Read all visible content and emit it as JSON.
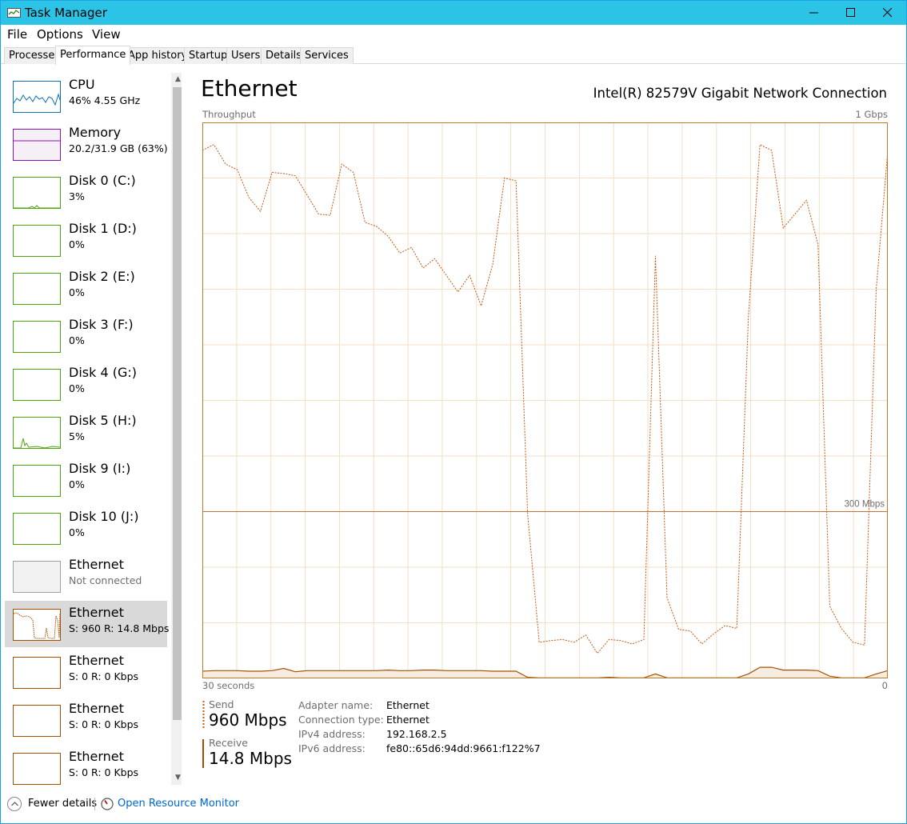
{
  "window": {
    "title": "Task Manager"
  },
  "menu": [
    "File",
    "Options",
    "View"
  ],
  "tabs": [
    "Processes",
    "Performance",
    "App history",
    "Startup",
    "Users",
    "Details",
    "Services"
  ],
  "active_tab": "Performance",
  "sidebar": {
    "items": [
      {
        "name": "CPU",
        "sub": "46%  4.55 GHz",
        "color": "#1171ae"
      },
      {
        "name": "Memory",
        "sub": "20.2/31.9 GB (63%)",
        "color": "#8b12ae"
      },
      {
        "name": "Disk 0 (C:)",
        "sub": "3%",
        "color": "#4da60c"
      },
      {
        "name": "Disk 1 (D:)",
        "sub": "0%",
        "color": "#4da60c"
      },
      {
        "name": "Disk 2 (E:)",
        "sub": "0%",
        "color": "#4da60c"
      },
      {
        "name": "Disk 3 (F:)",
        "sub": "0%",
        "color": "#4da60c"
      },
      {
        "name": "Disk 4 (G:)",
        "sub": "0%",
        "color": "#4da60c"
      },
      {
        "name": "Disk 5 (H:)",
        "sub": "5%",
        "color": "#4da60c"
      },
      {
        "name": "Disk 9 (I:)",
        "sub": "0%",
        "color": "#4da60c"
      },
      {
        "name": "Disk 10 (J:)",
        "sub": "0%",
        "color": "#4da60c"
      },
      {
        "name": "Ethernet",
        "sub": "Not connected",
        "color": "#a0a0a0"
      },
      {
        "name": "Ethernet",
        "sub": "S: 960  R: 14.8 Mbps",
        "color": "#a74f01"
      },
      {
        "name": "Ethernet",
        "sub": "S: 0  R: 0 Kbps",
        "color": "#a74f01"
      },
      {
        "name": "Ethernet",
        "sub": "S: 0  R: 0 Kbps",
        "color": "#a74f01"
      },
      {
        "name": "Ethernet",
        "sub": "S: 0  R: 0 Kbps",
        "color": "#a74f01"
      }
    ],
    "selected_index": 11
  },
  "main": {
    "title": "Ethernet",
    "adapter": "Intel(R) 82579V Gigabit Network Connection",
    "chart_top_left": "Throughput",
    "chart_top_right": "1 Gbps",
    "chart_bottom_left": "30 seconds",
    "chart_bottom_right": "0",
    "scale_marker": "300 Mbps"
  },
  "chart_data": {
    "type": "line",
    "title": "",
    "xlabel": "",
    "ylabel": "",
    "x_range_seconds": [
      30,
      0
    ],
    "y_unit": "Mbps",
    "ylim": [
      0,
      1000
    ],
    "marker_line": 300,
    "grid": true,
    "series": [
      {
        "name": "Send",
        "style": "dashed",
        "color": "#c85a14",
        "values": [
          950,
          960,
          925,
          915,
          865,
          840,
          910,
          908,
          904,
          870,
          835,
          833,
          925,
          910,
          820,
          813,
          795,
          765,
          775,
          738,
          755,
          725,
          695,
          725,
          670,
          745,
          900,
          895,
          295,
          65,
          68,
          70,
          65,
          78,
          45,
          70,
          68,
          62,
          70,
          760,
          145,
          88,
          85,
          62,
          80,
          95,
          90,
          650,
          960,
          950,
          810,
          835,
          860,
          780,
          130,
          90,
          65,
          60,
          700,
          950
        ]
      },
      {
        "name": "Receive",
        "style": "solid",
        "color": "#a74f01",
        "values": [
          13,
          14,
          14,
          14,
          13,
          13,
          14,
          18,
          12,
          14,
          14,
          14,
          14,
          14,
          14,
          14,
          15,
          14,
          14,
          15,
          15,
          14,
          14,
          14,
          14,
          13,
          13,
          13,
          2,
          1,
          1,
          1,
          1,
          1,
          1,
          2,
          1,
          1,
          1,
          8,
          1,
          1,
          1,
          1,
          1,
          1,
          1,
          8,
          20,
          20,
          15,
          15,
          15,
          14,
          4,
          1,
          1,
          1,
          8,
          14
        ]
      }
    ]
  },
  "stats": {
    "send_label": "Send",
    "send_value": "960 Mbps",
    "receive_label": "Receive",
    "receive_value": "14.8 Mbps"
  },
  "details": [
    {
      "key": "Adapter name:",
      "value": "Ethernet"
    },
    {
      "key": "Connection type:",
      "value": "Ethernet"
    },
    {
      "key": "IPv4 address:",
      "value": "192.168.2.5"
    },
    {
      "key": "IPv6 address:",
      "value": "fe80::65d6:94dd:9661:f122%7"
    }
  ],
  "footer": {
    "fewer_details": "Fewer details",
    "open_resource_monitor": "Open Resource Monitor"
  },
  "colors": {
    "titlebar": "#2bc4e6",
    "chart_border": "#b87d2b",
    "chart_grid": "#f2dfc4",
    "send_line": "#c85a14",
    "receive_line": "#a74f01",
    "receive_fill": "#f7ece1",
    "link": "#0066cc"
  }
}
